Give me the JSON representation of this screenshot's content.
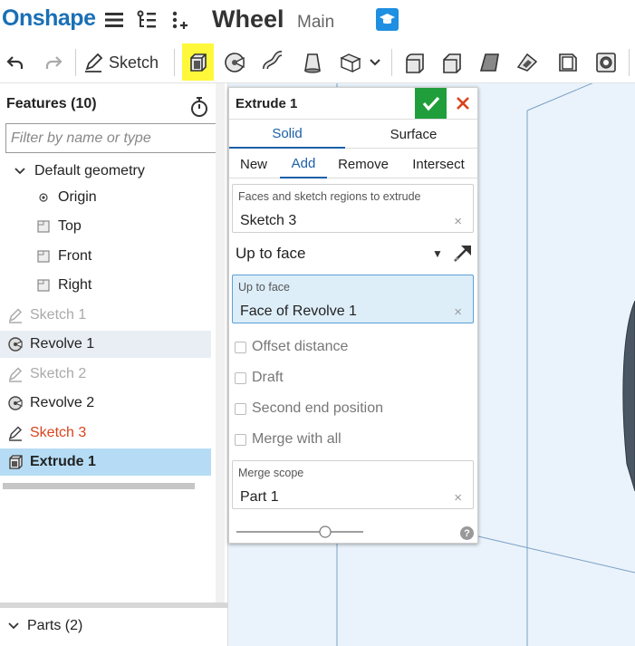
{
  "header": {
    "logo": "Onshape",
    "document_title": "Wheel",
    "workspace": "Main"
  },
  "toolbar": {
    "sketch_label": "Sketch",
    "highlight_color": "#fff83a"
  },
  "features_panel": {
    "title": "Features (10)",
    "filter_placeholder": "Filter by name or type",
    "items": [
      {
        "label": "Default geometry",
        "icon": "chevron-down-icon"
      },
      {
        "label": "Origin",
        "icon": "origin-icon"
      },
      {
        "label": "Top",
        "icon": "plane-icon"
      },
      {
        "label": "Front",
        "icon": "plane-icon"
      },
      {
        "label": "Right",
        "icon": "plane-icon"
      },
      {
        "label": "Sketch 1",
        "icon": "sketch-icon"
      },
      {
        "label": "Revolve 1",
        "icon": "revolve-icon"
      },
      {
        "label": "Sketch 2",
        "icon": "sketch-icon"
      },
      {
        "label": "Revolve 2",
        "icon": "revolve-icon"
      },
      {
        "label": "Sketch 3",
        "icon": "sketch-icon"
      },
      {
        "label": "Extrude 1",
        "icon": "extrude-icon"
      }
    ],
    "parts_label": "Parts (2)"
  },
  "extrude_dialog": {
    "title": "Extrude 1",
    "body_tabs": [
      "Solid",
      "Surface"
    ],
    "active_body_tab": "Solid",
    "operation_tabs": [
      "New",
      "Add",
      "Remove",
      "Intersect"
    ],
    "active_operation": "Add",
    "faces_field": {
      "label": "Faces and sketch regions to extrude",
      "value": "Sketch 3"
    },
    "end_type": "Up to face",
    "up_to_field": {
      "label": "Up to face",
      "value": "Face of Revolve 1"
    },
    "options": [
      "Offset distance",
      "Draft",
      "Second end position",
      "Merge with all"
    ],
    "merge_scope": {
      "label": "Merge scope",
      "value": "Part 1"
    },
    "clear_glyph": "×",
    "help_glyph": "?"
  },
  "colors": {
    "brand_blue": "#1a6fb5",
    "accept_green": "#1f9e3b",
    "cancel_red": "#d9441c",
    "active_feature_bg": "#b6dcf5",
    "sketch_error_red": "#d9441c"
  }
}
